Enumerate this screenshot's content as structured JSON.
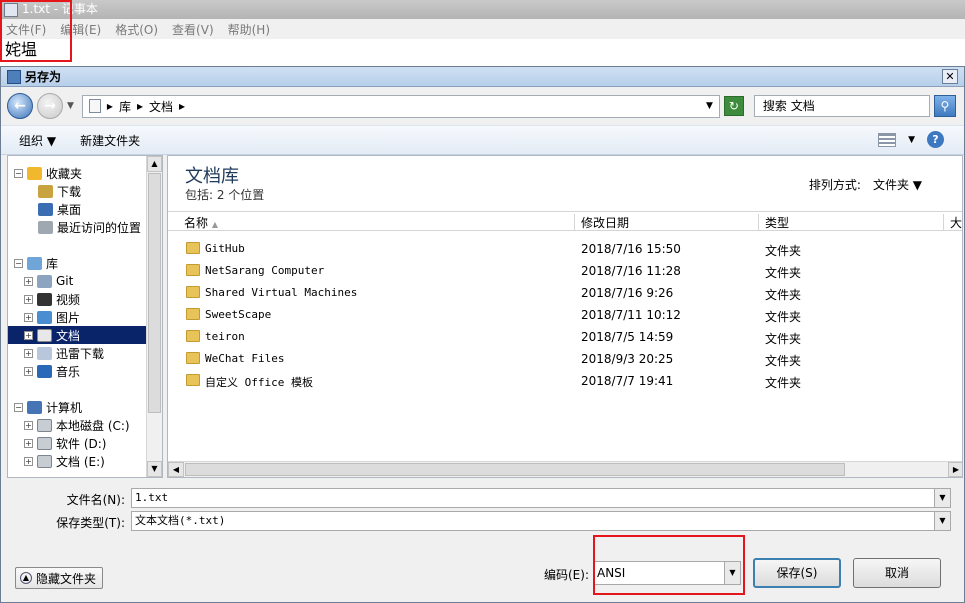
{
  "notepad": {
    "title": "1.txt - 记事本",
    "menu": [
      "文件(F)",
      "编辑(E)",
      "格式(O)",
      "查看(V)",
      "帮助(H)"
    ],
    "text": "姹塭"
  },
  "dialog": {
    "title": "另存为",
    "close": "✕"
  },
  "address": {
    "crumbs": [
      "库",
      "文档"
    ],
    "search_placeholder": "搜索 文档"
  },
  "toolbar": {
    "organize": "组织",
    "new_folder": "新建文件夹"
  },
  "tree": {
    "favorites": "收藏夹",
    "downloads": "下载",
    "desktop": "桌面",
    "recent": "最近访问的位置",
    "libraries": "库",
    "git": "Git",
    "videos": "视频",
    "pictures": "图片",
    "documents": "文档",
    "thunder": "迅雷下载",
    "music": "音乐",
    "computer": "计算机",
    "local_disk": "本地磁盘 (C:)",
    "software": "软件 (D:)",
    "docs_drive": "文档 (E:)"
  },
  "library": {
    "title": "文档库",
    "subtitle": "包括: 2 个位置",
    "sort_label": "排列方式:",
    "sort_value": "文件夹"
  },
  "columns": {
    "name": "名称",
    "modified": "修改日期",
    "type": "类型",
    "size": "大"
  },
  "files": [
    {
      "name": "GitHub",
      "date": "2018/7/16 15:50",
      "type": "文件夹"
    },
    {
      "name": "NetSarang Computer",
      "date": "2018/7/16 11:28",
      "type": "文件夹"
    },
    {
      "name": "Shared Virtual Machines",
      "date": "2018/7/16 9:26",
      "type": "文件夹"
    },
    {
      "name": "SweetScape",
      "date": "2018/7/11 10:12",
      "type": "文件夹"
    },
    {
      "name": "teiron",
      "date": "2018/7/5 14:59",
      "type": "文件夹"
    },
    {
      "name": "WeChat Files",
      "date": "2018/9/3 20:25",
      "type": "文件夹"
    },
    {
      "name": "自定义 Office 模板",
      "date": "2018/7/7 19:41",
      "type": "文件夹"
    }
  ],
  "form": {
    "filename_label": "文件名(N):",
    "filename_value": "1.txt",
    "type_label": "保存类型(T):",
    "type_value": "文本文档(*.txt)",
    "encoding_label": "编码(E):",
    "encoding_value": "ANSI"
  },
  "buttons": {
    "hide_folders": "隐藏文件夹",
    "save": "保存(S)",
    "cancel": "取消"
  }
}
